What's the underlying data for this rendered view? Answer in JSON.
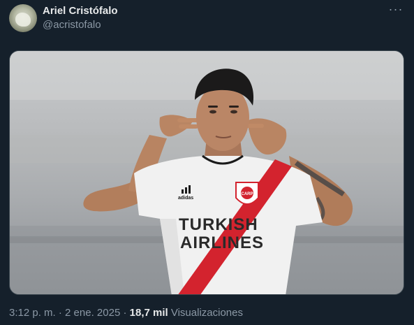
{
  "tweet": {
    "author": {
      "display_name": "Ariel Cristófalo",
      "handle": "@acristofalo"
    },
    "more_icon": "more-horizontal-icon",
    "more_glyph": "···",
    "media": {
      "jersey_text_line1": "TURKISH",
      "jersey_text_line2": "AIRLINES",
      "jersey_brand": "adidas",
      "crest_text": "CARP"
    },
    "time": "3:12 p. m.",
    "separator": " · ",
    "date": "2 ene. 2025",
    "views_count": "18,7 mil",
    "views_label": "Visualizaciones"
  },
  "colors": {
    "background": "#15202b",
    "primary_text": "#e7e9ea",
    "secondary_text": "#8b98a5",
    "jersey_stripe": "#d3232e"
  }
}
